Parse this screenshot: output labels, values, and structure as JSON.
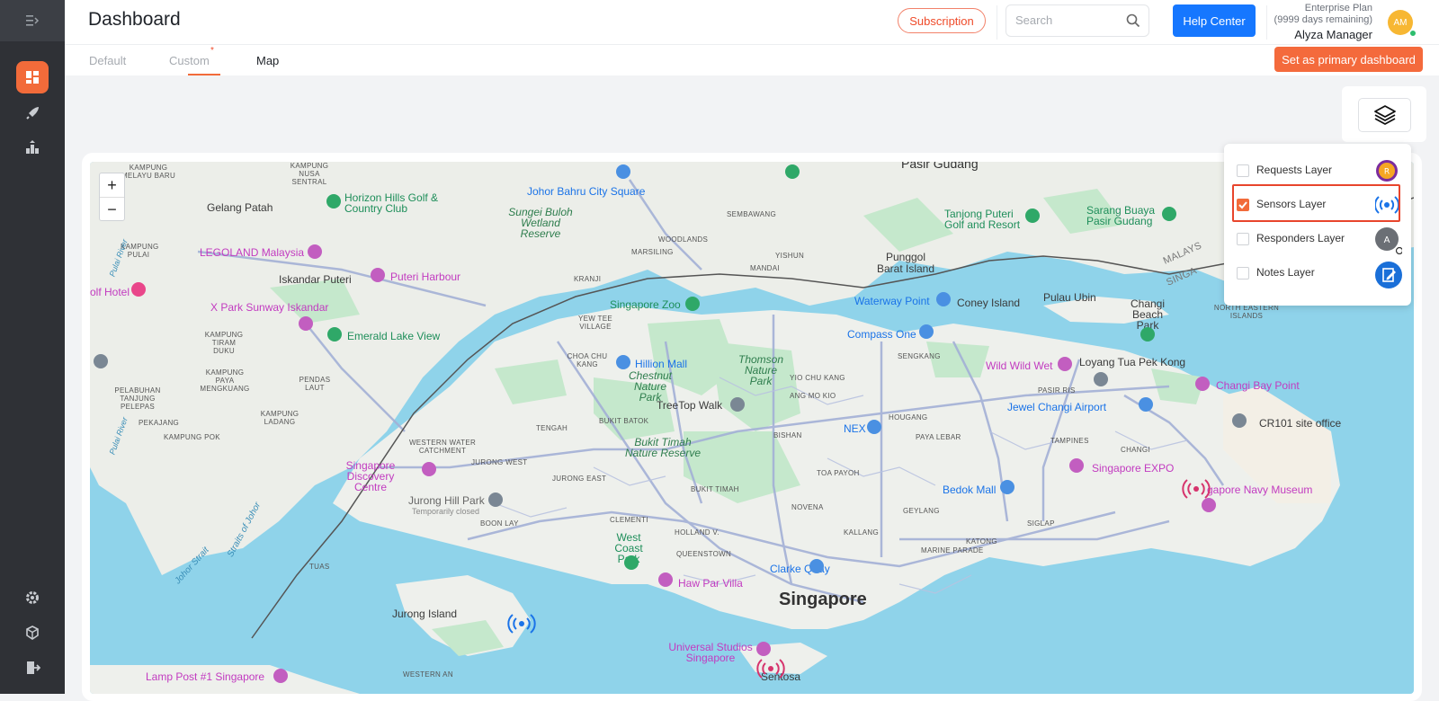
{
  "header": {
    "title": "Dashboard",
    "subscription_label": "Subscription",
    "search_placeholder": "Search",
    "help_label": "Help Center",
    "plan_name": "Enterprise Plan",
    "plan_remaining": "(9999 days remaining)",
    "user_name": "Alyza Manager",
    "avatar_initials": "AM"
  },
  "tabs": [
    {
      "label": "Default"
    },
    {
      "label": "Custom"
    },
    {
      "label": "Map",
      "star": "*"
    }
  ],
  "primary_dashboard_label": "Set as primary dashboard",
  "zoom": {
    "in": "+",
    "out": "−"
  },
  "layers": [
    {
      "label": "Requests Layer",
      "checked": false,
      "icon_text": "R"
    },
    {
      "label": "Sensors Layer",
      "checked": true,
      "icon_text": ""
    },
    {
      "label": "Responders Layer",
      "checked": false,
      "icon_text": "A"
    },
    {
      "label": "Notes Layer",
      "checked": false,
      "icon_text": ""
    }
  ],
  "map_labels": {
    "pasir_gudang": "Pasir Gudang",
    "johor_bahru": "Johor Bahru City Square",
    "horizon": "Horizon Hills Golf & Country Club",
    "gelang_patah": "Gelang Patah",
    "legoland": "LEGOLAND Malaysia",
    "iskandar": "Iskandar Puteri",
    "puteri_harbour": "Puteri Harbour",
    "golf_hotel": "olf Hotel",
    "xpark": "X Park Sunway Iskandar",
    "emerald": "Emerald Lake View",
    "sungei_buloh": "Sungei Buloh Wetland Reserve",
    "sembawang": "SEMBAWANG",
    "woodlands": "WOODLANDS",
    "marsiling": "MARSILING",
    "yishun": "YISHUN",
    "mandai": "MANDAI",
    "kranji": "KRANJI",
    "punggol": "Punggol Barat Island",
    "tanjong_puteri": "Tanjong Puteri Golf and Resort",
    "sarang_buaya": "Sarang Buaya Pasir Gudang",
    "waterway": "Waterway Point",
    "coney": "Coney Island",
    "pulau_ubin": "Pulau Ubin",
    "changi_beach": "Changi Beach Park",
    "ne_islands": "NORTH EASTERN ISLANDS",
    "singapore_zoo": "Singapore Zoo",
    "yew_tee": "YEW TEE VILLAGE",
    "compass": "Compass One",
    "sengkang": "SENGKANG",
    "thomson": "Thomson Nature Park",
    "choa_chu_kang": "CHOA CHU KANG",
    "hillion": "Hillion Mall",
    "chestnut": "Chestnut Nature Park",
    "yio_chu_kang": "YIO CHU KANG",
    "ang_mo_kio": "ANG MO KIO",
    "wild_wild_wet": "Wild Wild Wet",
    "loyang": "Loyang Tua Pek Kong",
    "pasir_ris": "PASIR RIS",
    "changi_bay": "Changi Bay Point",
    "treetop": "TreeTop Walk",
    "tengah": "TENGAH",
    "bukit_batok": "BUKIT BATOK",
    "hougang": "HOUGANG",
    "jewel": "Jewel Changi Airport",
    "cr101": "CR101 site office",
    "bishan": "BISHAN",
    "nex": "NEX",
    "paya_lebar": "PAYA LEBAR",
    "tampines": "TAMPINES",
    "western_water": "WESTERN WATER CATCHMENT",
    "jurong_west": "JURONG WEST",
    "bukit_timah": "Bukit Timah Nature Reserve",
    "changi": "CHANGI",
    "singapore_expo": "Singapore EXPO",
    "discovery": "Singapore Discovery Centre",
    "jurong_east": "JURONG EAST",
    "toa_payoh": "TOA PAYOH",
    "navy_museum": "gapore Navy Museum",
    "jurong_hill": "Jurong Hill Park",
    "temp_closed": "Temporarily closed",
    "bukit_timah_area": "BUKIT TIMAH",
    "novena": "NOVENA",
    "bedok": "Bedok Mall",
    "boon_lay": "BOON LAY",
    "geylang": "GEYLANG",
    "clementi": "CLEMENTI",
    "holland": "HOLLAND V.",
    "kallang": "KALLANG",
    "katong": "KATONG",
    "siglap": "SIGLAP",
    "west_coast": "West Coast Park",
    "marine_parade": "MARINE PARADE",
    "tuas": "TUAS",
    "queenstown": "QUEENSTOWN",
    "clarke_quay": "Clarke Quay",
    "haw_par": "Haw Par Villa",
    "singapore": "Singapore",
    "jurong_island": "Jurong Island",
    "universal": "Universal Studios Singapore",
    "sentosa": "Sentosa",
    "lamp_post": "Lamp Post #1 Singapore",
    "western_an": "WESTERN AN",
    "kampung_melayu": "KAMPUNG MELAYU BARU",
    "kampung_pulai": "KAMPUNG PULAI",
    "kampung_senai": "KAMPUNG NUSA SENTRAL",
    "kampung_tiram": "KAMPUNG TIRAM DUKU",
    "kampung_payang": "KAMPUNG PAYA MENGKUANG",
    "pelabuhan": "PELABUHAN TANJUNG PELEPAS",
    "pekajang": "PEKAJANG",
    "kampung_pok": "KAMPUNG POK",
    "pendas": "PENDAS LAUT",
    "kampung_ladang": "KAMPUNG LADANG",
    "malaysia_edge": "MALAYS",
    "singa_edge": "SINGA",
    "pulai_river": "Pulai River",
    "johor_strait": "Johor Strait",
    "straits_johor": "Straits of Johor"
  },
  "colors": {
    "accent": "#f26b3a",
    "sidebar": "#2f3136",
    "help_blue": "#1677ff",
    "water": "#8fd3ea",
    "land": "#eef0ec",
    "park": "#c5e8cc"
  }
}
